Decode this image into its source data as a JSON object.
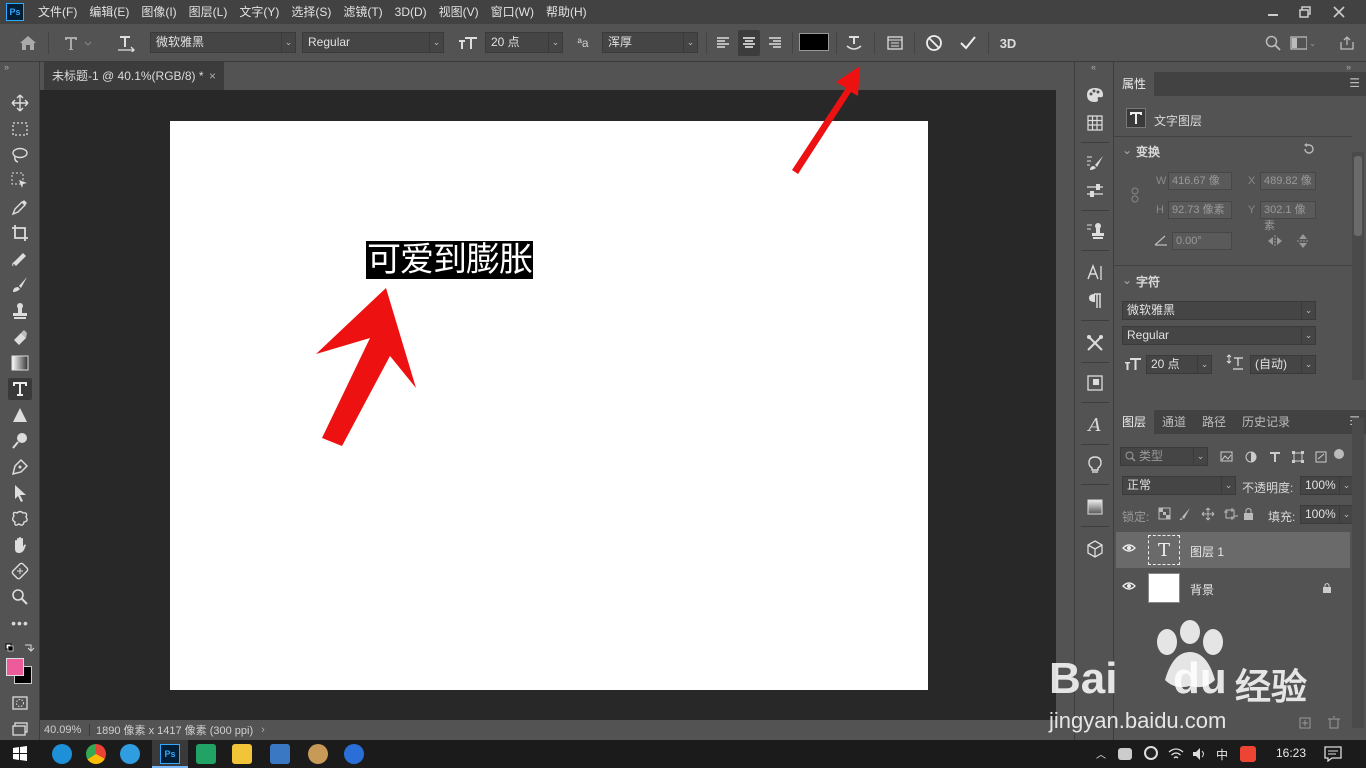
{
  "menu": {
    "logo": "Ps",
    "items": [
      "文件(F)",
      "编辑(E)",
      "图像(I)",
      "图层(L)",
      "文字(Y)",
      "选择(S)",
      "滤镜(T)",
      "3D(D)",
      "视图(V)",
      "窗口(W)",
      "帮助(H)"
    ]
  },
  "options": {
    "font_family": "微软雅黑",
    "font_style": "Regular",
    "font_size": "20 点",
    "antialias_label": "ªa",
    "antialias": "浑厚",
    "three_d_label": "3D",
    "text_color": "#000000"
  },
  "document": {
    "tab_title": "未标题-1 @ 40.1%(RGB/8) *",
    "tab_close": "×",
    "canvas_text": "可爱到膨胀",
    "status_zoom": "40.09%",
    "status_info": "1890 像素 x 1417 像素 (300 ppi)",
    "status_arrow": "›"
  },
  "properties": {
    "tab": "属性",
    "layer_type": "文字图层",
    "transform_title": "变换",
    "w_label": "W",
    "w_value": "416.67 像",
    "x_label": "X",
    "x_value": "489.82 像",
    "h_label": "H",
    "h_value": "92.73 像素",
    "y_label": "Y",
    "y_value": "302.1 像素",
    "angle_value": "0.00°",
    "character_title": "字符",
    "font_family": "微软雅黑",
    "font_style": "Regular",
    "font_size": "20 点",
    "leading": "(自动)"
  },
  "layers": {
    "tabs": [
      "图层",
      "通道",
      "路径",
      "历史记录"
    ],
    "filter_placeholder": "类型",
    "blend_mode": "正常",
    "opacity_label": "不透明度:",
    "opacity_value": "100%",
    "lock_label": "锁定:",
    "fill_label": "填充:",
    "fill_value": "100%",
    "items": [
      {
        "name": "图层 1",
        "thumb": "T"
      },
      {
        "name": "背景"
      }
    ]
  },
  "colors": {
    "foreground": "#ee5b9a",
    "background": "#000000",
    "arrow": "#ee1111"
  },
  "watermark": {
    "brand": "Bai",
    "brand2": "du",
    "cn": "经验",
    "url": "jingyan.baidu.com"
  },
  "taskbar": {
    "lang": "中",
    "time": "16:23"
  }
}
